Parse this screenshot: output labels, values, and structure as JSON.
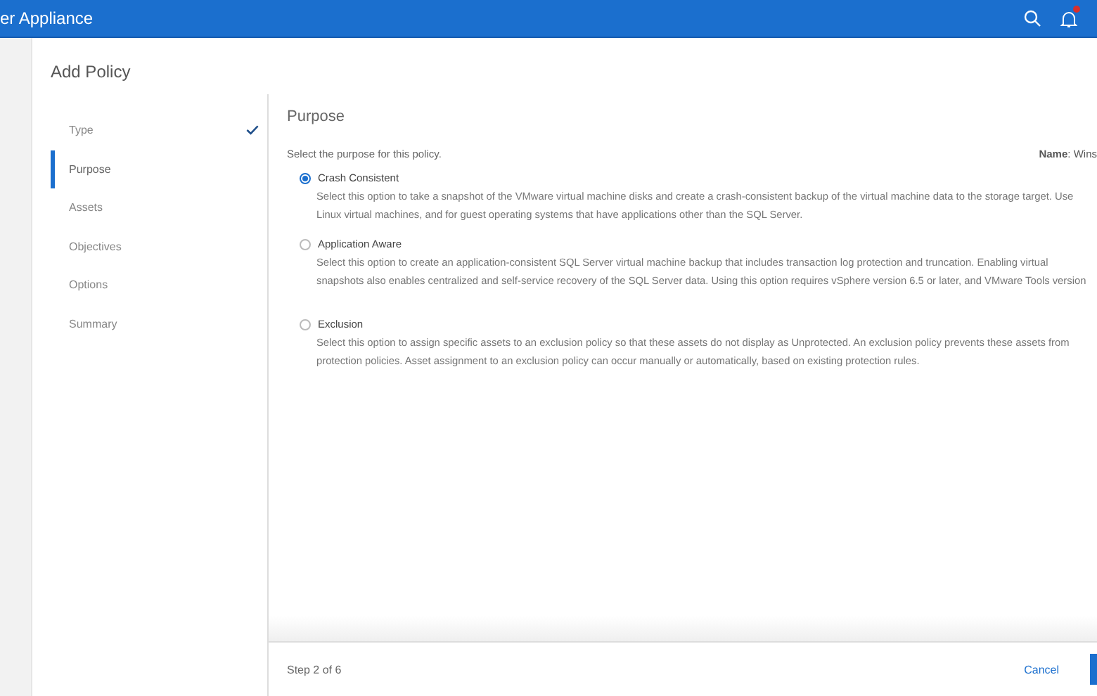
{
  "header": {
    "title": "er Appliance",
    "notification_badge": true
  },
  "dialog": {
    "title": "Add Policy",
    "steps": [
      {
        "label": "Type",
        "selected": false,
        "completed": true
      },
      {
        "label": "Purpose",
        "selected": true,
        "completed": false
      },
      {
        "label": "Assets",
        "selected": false,
        "completed": false
      },
      {
        "label": "Objectives",
        "selected": false,
        "completed": false
      },
      {
        "label": "Options",
        "selected": false,
        "completed": false
      },
      {
        "label": "Summary",
        "selected": false,
        "completed": false
      }
    ],
    "panel": {
      "title": "Purpose",
      "instruction": "Select the purpose for this policy.",
      "name": "**Name**: Wins",
      "options": [
        {
          "label": "Crash Consistent",
          "selected": true,
          "lines": [
            "Select this option to take a snapshot of the VMware virtual machine disks and create a crash-consistent backup of the virtual machine data to the storage target. Use",
            "Linux virtual machines, and for guest operating systems that have applications other than the SQL Server."
          ]
        },
        {
          "label": "Application Aware",
          "selected": false,
          "lines": [
            "Select this option to create an application-consistent SQL Server virtual machine backup that includes transaction log protection and truncation. Enabling virtual",
            "snapshots also enables centralized and self-service recovery of the SQL Server data. Using this option requires vSphere version 6.5 or later, and VMware Tools version"
          ]
        },
        {
          "label": "Exclusion",
          "selected": false,
          "lines": [
            "Select this option to assign specific assets to an exclusion policy so that these assets do not display as Unprotected. An exclusion policy prevents these assets from",
            "protection policies. Asset assignment to an exclusion policy can occur manually or automatically, based on existing protection rules."
          ]
        }
      ]
    },
    "footer": {
      "step": "Step 2 of 6",
      "cancel": "Cancel"
    }
  }
}
